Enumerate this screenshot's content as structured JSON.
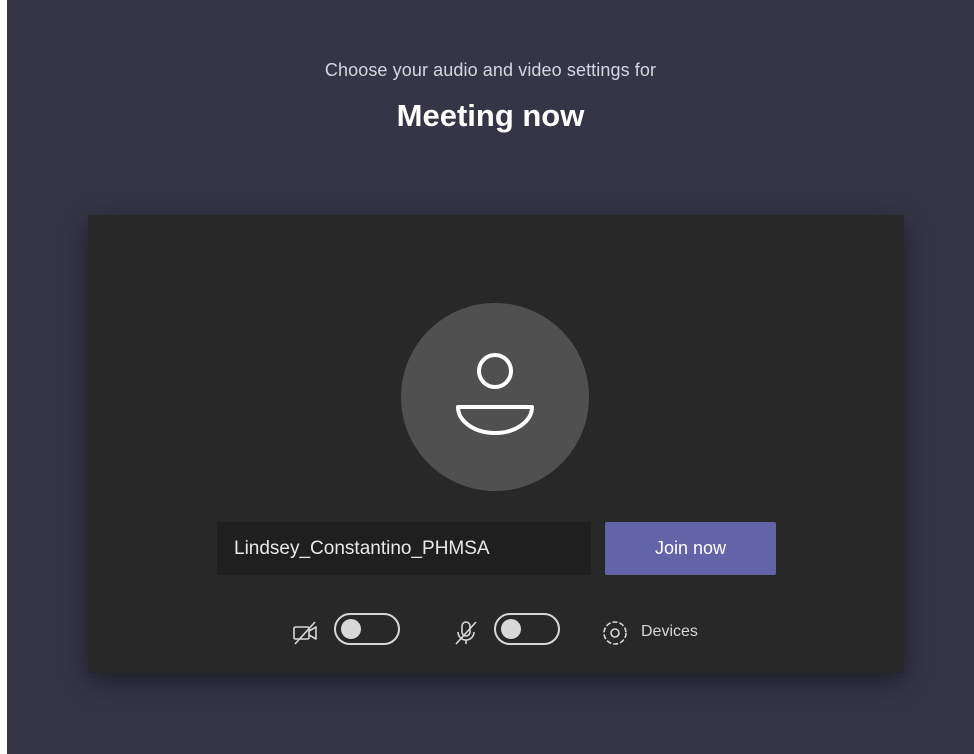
{
  "header": {
    "subtitle": "Choose your audio and video settings for",
    "meeting_title": "Meeting now"
  },
  "prejoin": {
    "name_field": {
      "value": "Lindsey_Constantino_PHMSA",
      "placeholder": ""
    },
    "join_button_label": "Join now",
    "camera": {
      "icon": "camera-off-icon",
      "state": "off"
    },
    "microphone": {
      "icon": "mic-off-icon",
      "state": "off"
    },
    "devices_label": "Devices",
    "devices_icon": "gear-icon"
  },
  "colors": {
    "background": "#353547",
    "panel": "#282828",
    "avatar_circle": "#505050",
    "accent": "#6264a7",
    "name_field_bg": "#1f1f1f"
  }
}
